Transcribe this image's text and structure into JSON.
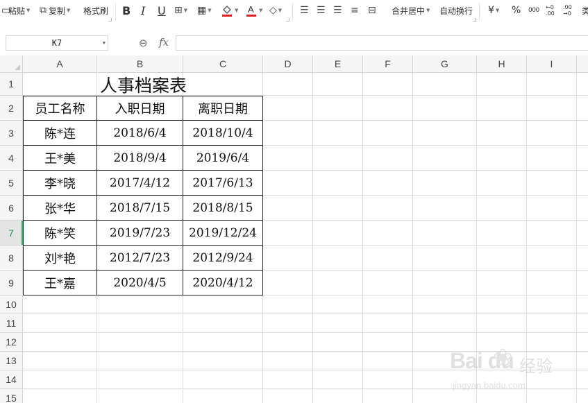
{
  "toolbar": {
    "paste": "粘贴",
    "copy": "复制",
    "format_painter": "格式刷",
    "bold": "B",
    "italic": "I",
    "underline": "U",
    "merge_center": "合并居中",
    "wrap_text": "自动换行",
    "currency": "¥",
    "percent": "%",
    "thousands": "000",
    "increase_decimal": "←0 .00",
    "decrease_decimal": ".00 →0",
    "next_group": "类",
    "font_color_letter": "A",
    "fill_color_accent": "#e02020",
    "font_color_accent": "#e02020"
  },
  "formula_bar": {
    "cell_ref": "K7",
    "fx_label": "fx",
    "value": ""
  },
  "columns": [
    "A",
    "B",
    "C",
    "D",
    "E",
    "F",
    "G",
    "H",
    "I"
  ],
  "rows": [
    "1",
    "2",
    "3",
    "4",
    "5",
    "6",
    "7",
    "8",
    "9",
    "10",
    "11",
    "12",
    "13",
    "14",
    "15"
  ],
  "active_row": "7",
  "sheet": {
    "title": "人事档案表",
    "headers": [
      "员工名称",
      "入职日期",
      "离职日期"
    ],
    "records": [
      [
        "陈*连",
        "2018/6/4",
        "2018/10/4"
      ],
      [
        "王*美",
        "2018/9/4",
        "2019/6/4"
      ],
      [
        "李*晓",
        "2017/4/12",
        "2017/6/13"
      ],
      [
        "张*华",
        "2018/7/15",
        "2018/8/15"
      ],
      [
        "陈*笑",
        "2019/7/23",
        "2019/12/24"
      ],
      [
        "刘*艳",
        "2012/7/23",
        "2012/9/24"
      ],
      [
        "王*嘉",
        "2020/4/5",
        "2020/4/12"
      ]
    ]
  },
  "watermark": {
    "logo": "Bai du",
    "text": "经验",
    "url": "jingyan.baidu.com"
  }
}
